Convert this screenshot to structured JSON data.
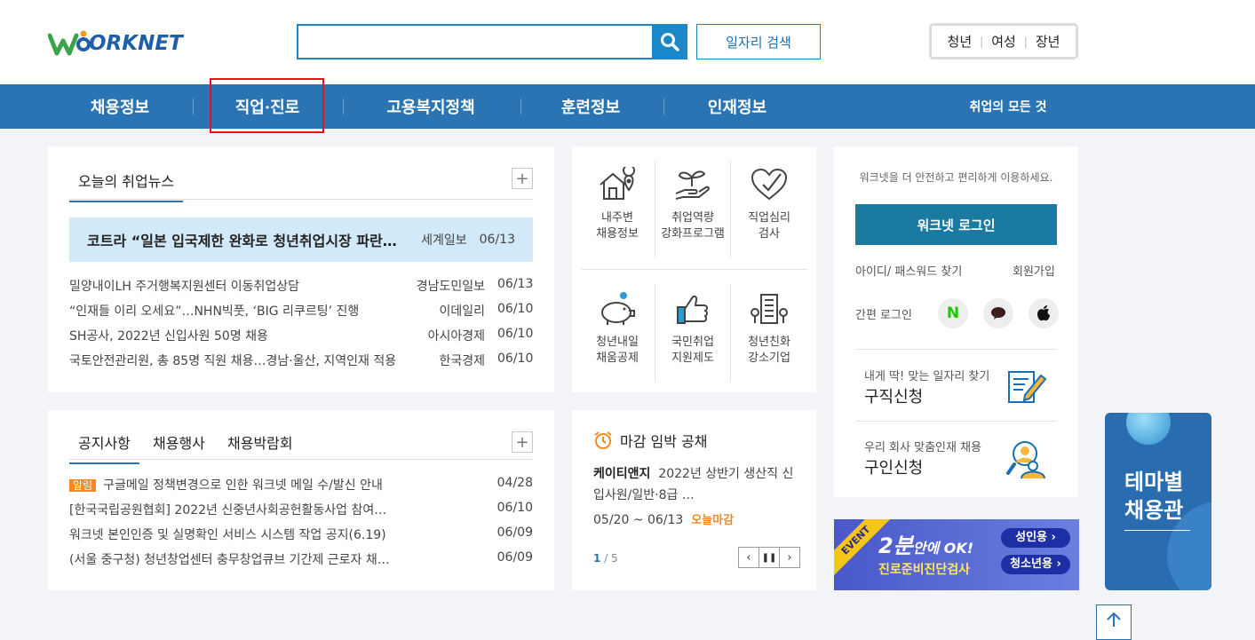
{
  "header": {
    "logo_text": "ORKNET",
    "search": {
      "value": "",
      "placeholder": ""
    },
    "job_search_label": "일자리 검색",
    "quick_links": [
      "청년",
      "여성",
      "장년"
    ]
  },
  "gnb": {
    "items": [
      "채용정보",
      "직업·진로",
      "고용복지정책",
      "훈련정보",
      "인재정보"
    ],
    "all_label": "취업의 모든 것"
  },
  "news": {
    "title": "오늘의 취업뉴스",
    "featured": {
      "title": "코트라 “일본 입국제한 완화로 청년취업시장 파란…",
      "source": "세계일보",
      "date": "06/13"
    },
    "items": [
      {
        "title": "밀양내이LH 주거행복지원센터 이동취업상담",
        "source": "경남도민일보",
        "date": "06/13"
      },
      {
        "title": "“인재들 이리 오세요”…NHN빅풋, ‘BIG 리쿠르팅’ 진행",
        "source": "이데일리",
        "date": "06/10"
      },
      {
        "title": "SH공사, 2022년 신입사원 50명 채용",
        "source": "아시아경제",
        "date": "06/10"
      },
      {
        "title": "국토안전관리원, 총 85명 직원 채용…경남·울산, 지역인재 적용",
        "source": "한국경제",
        "date": "06/10"
      }
    ]
  },
  "services": [
    {
      "line1": "내주변",
      "line2": "채용정보"
    },
    {
      "line1": "취업역량",
      "line2": "강화프로그램"
    },
    {
      "line1": "직업심리",
      "line2": "검사"
    },
    {
      "line1": "청년내일",
      "line2": "채움공제"
    },
    {
      "line1": "국민취업",
      "line2": "지원제도"
    },
    {
      "line1": "청년친화",
      "line2": "강소기업"
    }
  ],
  "login": {
    "desc": "워크넷을 더 안전하고 편리하게 이용하세요.",
    "button": "워크넷 로그인",
    "find_account": "아이디/ 패스워드 찾기",
    "signup": "회원가입",
    "easy_login": "간편 로그인",
    "job_seek": {
      "sub": "내게 딱! 맞는 일자리 찾기",
      "main": "구직신청"
    },
    "recruit": {
      "sub": "우리 회사 맞춤인재 채용",
      "main": "구인신청"
    }
  },
  "notice": {
    "tabs": [
      "공지사항",
      "채용행사",
      "채용박람회"
    ],
    "badge": "알림",
    "items": [
      {
        "title": "구글메일 정책변경으로 인한 워크넷 메일 수/발신 안내",
        "date": "04/28"
      },
      {
        "title": "[한국국립공원협회] 2022년 신중년사회공헌활동사업 참여…",
        "date": "06/10"
      },
      {
        "title": "워크넷 본인인증 및 실명확인 서비스 시스템 작업 공지(6.19)",
        "date": "06/09"
      },
      {
        "title": "(서울 중구청) 청년창업센터 충무창업큐브 기간제 근로자 채…",
        "date": "06/09"
      }
    ]
  },
  "deadline": {
    "title": "마감 임박 공채",
    "company": "케이티앤지",
    "desc": "2022년 상반기 생산직 신입사원/일반·8급 …",
    "period": "05/20 ~ 06/13",
    "tag": "오늘마감",
    "page": "1",
    "total": "/ 5"
  },
  "banner": {
    "event": "EVENT",
    "headline": "2분",
    "headline2": "안에 OK!",
    "sub": "진로준비진단검사",
    "adult": "성인용",
    "youth": "청소년용"
  },
  "theme": {
    "line1": "테마별",
    "line2": "채용관"
  },
  "colors": {
    "primary": "#2b74b3",
    "search": "#1a87c9",
    "login": "#1b7aa1",
    "highlight": "#e0161c",
    "accent": "#f08a24"
  }
}
